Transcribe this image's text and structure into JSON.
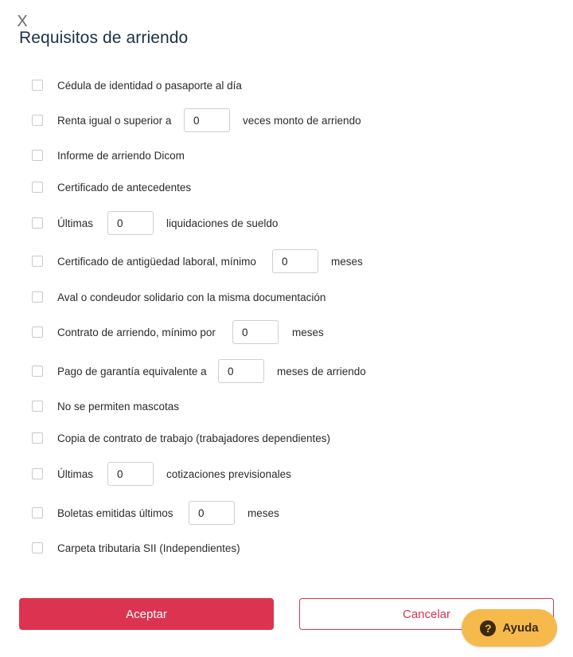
{
  "dialog": {
    "close_glyph": "X",
    "title": "Requisitos de arriendo"
  },
  "requirements": [
    {
      "label": "Cédula de identidad o pasaporte al día"
    },
    {
      "before": "Renta igual o superior a",
      "value": "0",
      "after": "veces monto de arriendo"
    },
    {
      "label": "Informe de arriendo Dicom"
    },
    {
      "label": "Certificado de antecedentes"
    },
    {
      "before": "Últimas",
      "value": "0",
      "after": "liquidaciones de sueldo"
    },
    {
      "before": "Certificado de antigüedad laboral, mínimo",
      "value": "0",
      "after": "meses"
    },
    {
      "label": "Aval o condeudor solidario con la misma documentación"
    },
    {
      "before": "Contrato de arriendo, mínimo por",
      "value": "0",
      "after": "meses"
    },
    {
      "before": "Pago de garantía equivalente a",
      "value": "0",
      "after": "meses de arriendo"
    },
    {
      "label": "No se permiten mascotas"
    },
    {
      "label": "Copia de contrato de trabajo (trabajadores dependientes)"
    },
    {
      "before": "Últimas",
      "value": "0",
      "after": "cotizaciones previsionales"
    },
    {
      "before": "Boletas emitidas últimos",
      "value": "0",
      "after": "meses"
    },
    {
      "label": "Carpeta tributaria SII (Independientes)"
    }
  ],
  "actions": {
    "accept_label": "Aceptar",
    "cancel_label": "Cancelar"
  },
  "help": {
    "icon": "question-icon",
    "icon_glyph": "?",
    "label": "Ayuda"
  },
  "colors": {
    "primary": "#dc3450",
    "title": "#1c3146",
    "help_bg": "#f6b94c"
  }
}
